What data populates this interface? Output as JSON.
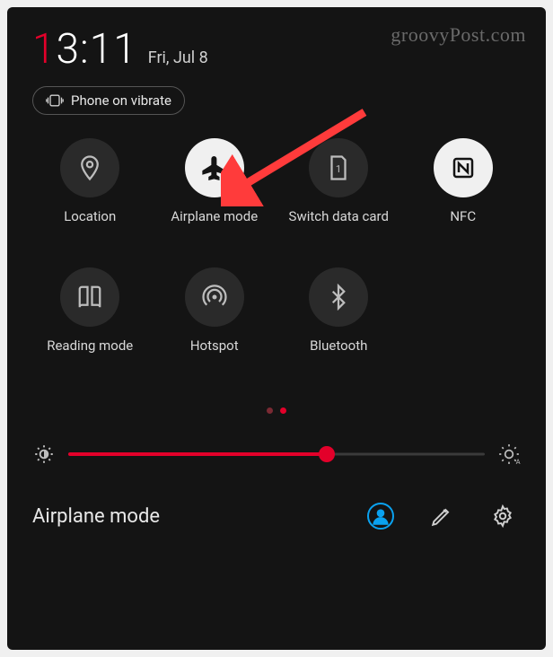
{
  "watermark": "groovyPost.com",
  "time": {
    "hour_first": "1",
    "hour_rest": "3:11"
  },
  "date": "Fri, Jul 8",
  "vibrate_label": "Phone on vibrate",
  "tiles": [
    {
      "label": "Location",
      "active": false,
      "icon": "location"
    },
    {
      "label": "Airplane mode",
      "active": true,
      "icon": "airplane"
    },
    {
      "label": "Switch data card",
      "active": false,
      "icon": "sim"
    },
    {
      "label": "NFC",
      "active": true,
      "icon": "nfc"
    },
    {
      "label": "Reading mode",
      "active": false,
      "icon": "book"
    },
    {
      "label": "Hotspot",
      "active": false,
      "icon": "hotspot"
    },
    {
      "label": "Bluetooth",
      "active": false,
      "icon": "bluetooth"
    }
  ],
  "pager": {
    "current": 1,
    "total": 2
  },
  "brightness_percent": 62,
  "footer": {
    "title": "Airplane mode",
    "user_label": "user-icon",
    "edit_label": "edit-icon",
    "settings_label": "gear-icon"
  },
  "colors": {
    "accent": "#e3002a",
    "blue": "#0aa2f0"
  }
}
